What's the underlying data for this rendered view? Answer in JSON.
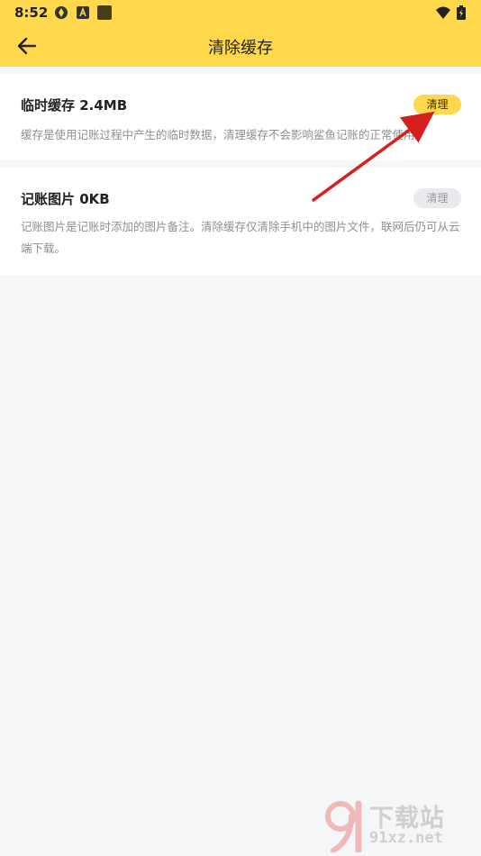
{
  "status_bar": {
    "time": "8:52"
  },
  "header": {
    "title": "清除缓存"
  },
  "items": [
    {
      "title": "临时缓存 2.4MB",
      "description": "缓存是使用记账过程中产生的临时数据，清理缓存不会影响鲨鱼记账的正常使用。",
      "button_label": "清理",
      "button_state": "active"
    },
    {
      "title": "记账图片 0KB",
      "description": "记账图片是记账时添加的图片备注。清除缓存仅清除手机中的图片文件，联网后仍可从云端下载。",
      "button_label": "清理",
      "button_state": "disabled"
    }
  ],
  "watermark": {
    "logo_text": "下载站",
    "url": "91xz.net"
  },
  "colors": {
    "accent": "#ffd84c",
    "background": "#f5f6f8",
    "card": "#ffffff",
    "arrow": "#d62020"
  }
}
